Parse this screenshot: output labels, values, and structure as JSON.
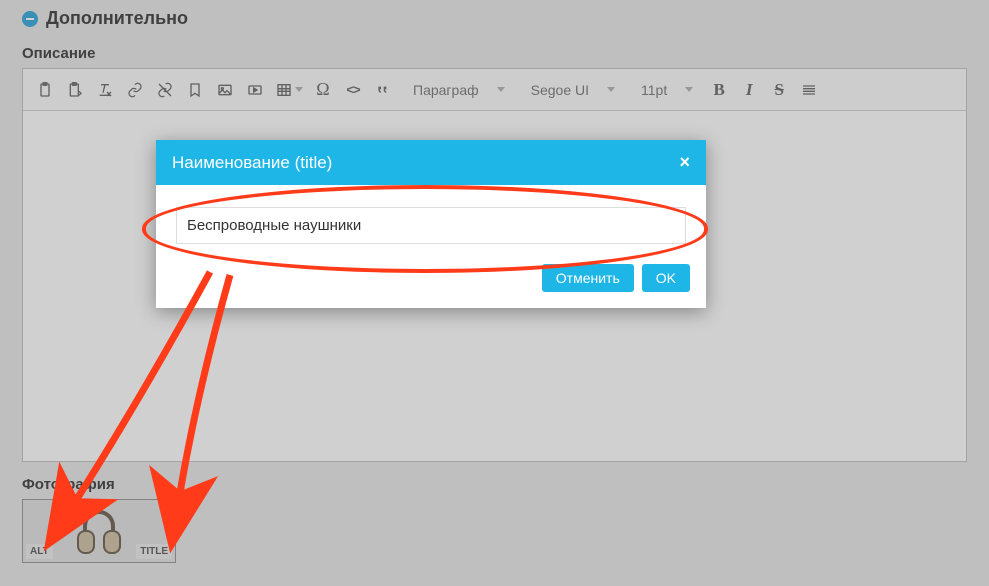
{
  "section": {
    "title": "Дополнительно"
  },
  "description": {
    "label": "Описание"
  },
  "toolbar": {
    "paragraph": "Параграф",
    "font": "Segoe UI",
    "size": "11pt",
    "omega": "Ω",
    "code": "<>",
    "bold": "B",
    "italic": "I",
    "strike": "S"
  },
  "photos": {
    "label": "Фотография",
    "alt_badge": "ALT",
    "title_badge": "TITLE"
  },
  "modal": {
    "title": "Наименование (title)",
    "close": "×",
    "value": "Беспроводные наушники",
    "cancel": "Отменить",
    "ok": "OK"
  }
}
